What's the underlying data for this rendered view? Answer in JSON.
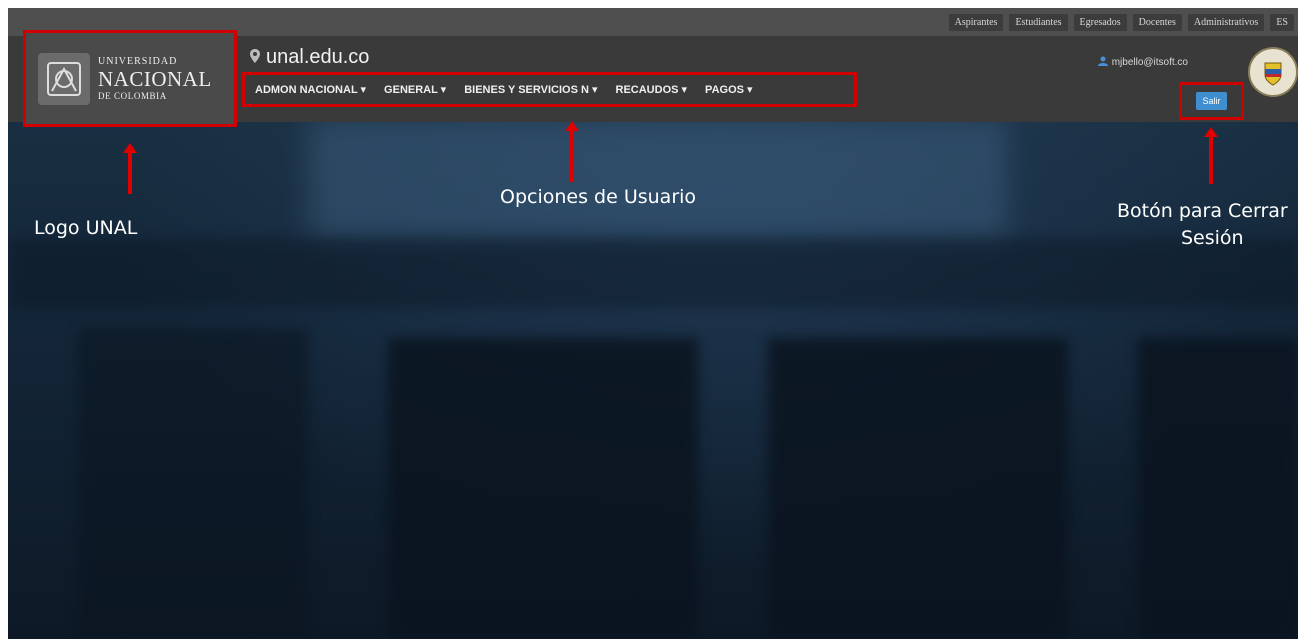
{
  "utility_links": [
    "Aspirantes",
    "Estudiantes",
    "Egresados",
    "Docentes",
    "Administrativos",
    "ES"
  ],
  "logo": {
    "line1": "UNIVERSIDAD",
    "line2": "NACIONAL",
    "line3": "DE COLOMBIA"
  },
  "site_name": "unal.edu.co",
  "nav_items": [
    "ADMON NACIONAL ▾",
    "GENERAL ▾",
    "BIENES Y SERVICIOS N ▾",
    "RECAUDOS ▾",
    "PAGOS ▾"
  ],
  "user_email": "mjbello@itsoft.co",
  "salir_label": "Salir",
  "annotations": {
    "logo": "Logo UNAL",
    "nav": "Opciones de Usuario",
    "logout_line1": "Botón para Cerrar",
    "logout_line2": "Sesión"
  },
  "colors": {
    "highlight": "#d10000",
    "button": "#3f8fd0"
  },
  "icons": {
    "location": "location-pin-icon",
    "user": "user-icon",
    "seal": "coat-of-arms-icon"
  }
}
